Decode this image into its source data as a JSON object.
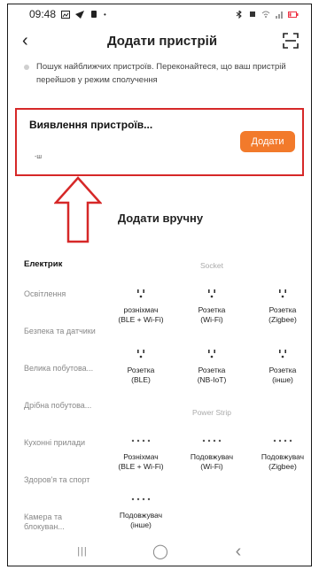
{
  "status_bar": {
    "time": "09:48",
    "signal_text": "⊳ ⬛ ·"
  },
  "header": {
    "title": "Додати пристрій",
    "back_icon": "‹",
    "scan_icon": "scan-icon"
  },
  "hint": {
    "text": "Пошук найближчих пристроїв. Переконайтеся, що ваш пристрій перейшов у режим сполучення"
  },
  "discovery": {
    "title": "Виявлення пристроїв...",
    "sub": "-ш",
    "add_label": "Додати",
    "accent": "#f27a2b",
    "highlight": "#d62828"
  },
  "manual": {
    "title": "Додати вручну"
  },
  "categories": [
    {
      "label": "Електрик"
    },
    {
      "label": "Освітлення"
    },
    {
      "label": "Безпека та датчики"
    },
    {
      "label": "Велика побутова..."
    },
    {
      "label": "Дрібна побутова..."
    },
    {
      "label": "Кухонні прилади"
    },
    {
      "label": "Здоров'я та спорт"
    },
    {
      "label": "Камера та блокуван..."
    }
  ],
  "sections": {
    "socket": "Socket",
    "power_strip": "Power Strip"
  },
  "socket_devices": [
    {
      "name": "розніхмач",
      "sub": "(BLE + Wi-Fi)"
    },
    {
      "name": "Розетка",
      "sub": "(Wi-Fi)"
    },
    {
      "name": "Розетка",
      "sub": "(Zigbee)"
    },
    {
      "name": "Розетка",
      "sub": "(BLE)"
    },
    {
      "name": "Розетка",
      "sub": "(NB-IoT)"
    },
    {
      "name": "Розетка",
      "sub": "(інше)"
    }
  ],
  "strip_devices": [
    {
      "name": "Розніхмач",
      "sub": "(BLE + Wi-Fi)"
    },
    {
      "name": "Подовжувач",
      "sub": "(Wi-Fi)"
    },
    {
      "name": "Подовжувач",
      "sub": "(Zigbee)"
    },
    {
      "name": "Подовжувач",
      "sub": "(інше)"
    }
  ],
  "navbar": {
    "recents": "|||",
    "home": "◯",
    "back": "‹"
  }
}
